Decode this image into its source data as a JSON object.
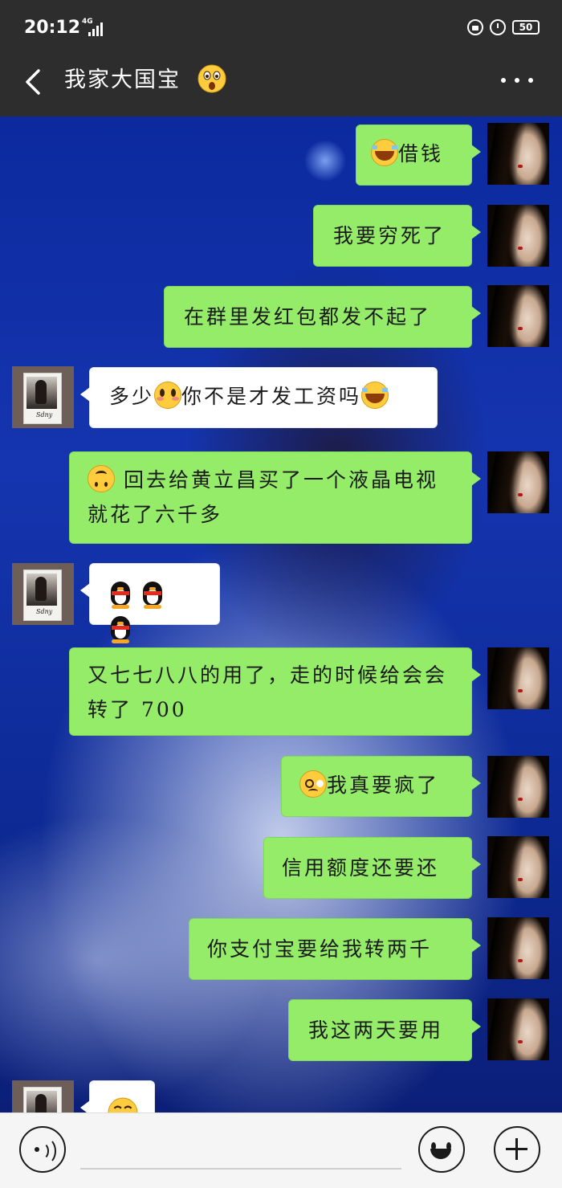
{
  "status_bar": {
    "time": "20:12",
    "network": "4G",
    "battery": "50"
  },
  "header": {
    "title": "我家大国宝",
    "title_emoji": "astonished-face-emoji"
  },
  "messages": [
    {
      "side": "me",
      "emoji_before": "laughing-crying-emoji",
      "text": "借钱"
    },
    {
      "side": "me",
      "text": "我要穷死了"
    },
    {
      "side": "me",
      "text": "在群里发红包都发不起了"
    },
    {
      "side": "other",
      "text_parts": [
        "多少",
        "你不是才发工资吗"
      ],
      "emoji_mid": "shy-face-emoji",
      "emoji_after": "laughing-crying-emoji"
    },
    {
      "side": "me",
      "emoji_before": "upside-down-face-emoji",
      "text": " 回去给黄立昌买了一个液晶电视就花了六千多"
    },
    {
      "side": "other",
      "emoji_only": [
        "qq-penguin-emoji",
        "qq-penguin-emoji",
        "qq-penguin-emoji"
      ]
    },
    {
      "side": "me",
      "text": "又七七八八的用了，走的时候给会会转了 700"
    },
    {
      "side": "me",
      "emoji_before": "woozy-face-emoji",
      "text": "我真要疯了"
    },
    {
      "side": "me",
      "text": "信用额度还要还"
    },
    {
      "side": "me",
      "text": "你支付宝要给我转两千"
    },
    {
      "side": "me",
      "text": "我这两天要用"
    },
    {
      "side": "other",
      "emoji_only": [
        "smiling-face-emoji"
      ]
    }
  ],
  "input_bar": {
    "placeholder": ""
  }
}
